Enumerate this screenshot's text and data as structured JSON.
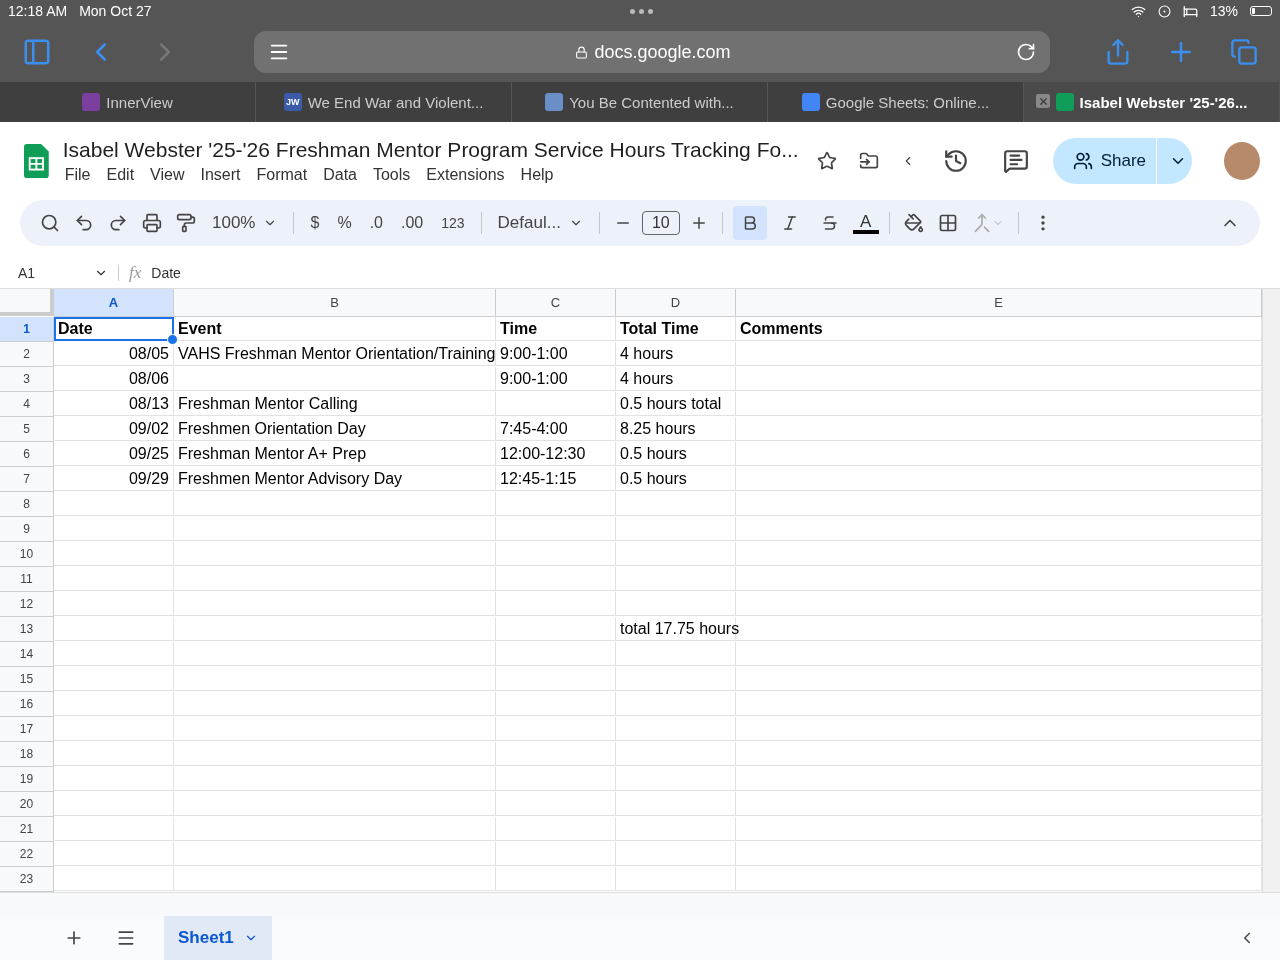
{
  "status_bar": {
    "time": "12:18 AM",
    "date": "Mon Oct 27",
    "battery": "13%"
  },
  "browser": {
    "url": "docs.google.com",
    "tabs": [
      {
        "label": "InnerView",
        "selected": false,
        "color": "#7b3fa0"
      },
      {
        "label": "We End War and Violent...",
        "selected": false,
        "color": "#3b5ba9",
        "favicon_text": "JW"
      },
      {
        "label": "You Be Contented with...",
        "selected": false,
        "color": "#6a8fc8"
      },
      {
        "label": "Google Sheets: Online...",
        "selected": false,
        "color": "#4285f4"
      },
      {
        "label": "Isabel Webster '25-'26...",
        "selected": true,
        "color": "#0f9d58"
      }
    ]
  },
  "doc": {
    "title": "Isabel Webster '25-'26 Freshman Mentor Program Service Hours Tracking Fo...",
    "menus": [
      "File",
      "Edit",
      "View",
      "Insert",
      "Format",
      "Data",
      "Tools",
      "Extensions",
      "Help"
    ],
    "share": "Share"
  },
  "toolbar": {
    "zoom": "100%",
    "currency": "$",
    "percent": "%",
    "decrease_decimal": ".0",
    "increase_decimal": ".00",
    "number_format": "123",
    "font": "Defaul...",
    "font_size": "10",
    "bold": true,
    "text_color": "A"
  },
  "formula_bar": {
    "cell": "A1",
    "fx": "fx",
    "value": "Date"
  },
  "sheet": {
    "columns": [
      {
        "label": "A",
        "selected": true
      },
      {
        "label": "B",
        "selected": false
      },
      {
        "label": "C",
        "selected": false
      },
      {
        "label": "D",
        "selected": false
      },
      {
        "label": "E",
        "selected": false
      }
    ],
    "header_row": {
      "number": "1",
      "selected": true,
      "cells": {
        "a": "Date",
        "b": "Event",
        "c": "Time",
        "d": "Total Time",
        "e": "Comments"
      }
    },
    "rows": [
      {
        "number": "2",
        "selected": false,
        "cells": {
          "a": "08/05",
          "b": "VAHS Freshman Mentor Orientation/Training",
          "c": "9:00-1:00",
          "d": "4 hours"
        }
      },
      {
        "number": "3",
        "selected": false,
        "cells": {
          "a": "08/06",
          "c": "9:00-1:00",
          "d": "4 hours"
        }
      },
      {
        "number": "4",
        "selected": false,
        "cells": {
          "a": "08/13",
          "b": "Freshman Mentor Calling",
          "d": "0.5 hours total"
        }
      },
      {
        "number": "5",
        "selected": false,
        "cells": {
          "a": "09/02",
          "b": "Freshmen Orientation Day",
          "c": "7:45-4:00",
          "d": "8.25 hours"
        }
      },
      {
        "number": "6",
        "selected": false,
        "cells": {
          "a": "09/25",
          "b": "Freshman Mentor A+ Prep",
          "c": "12:00-12:30",
          "d": "0.5 hours"
        }
      },
      {
        "number": "7",
        "selected": false,
        "cells": {
          "a": "09/29",
          "b": "Freshmen Mentor Advisory Day",
          "c": "12:45-1:15",
          "d": "0.5 hours"
        }
      },
      {
        "number": "8",
        "selected": false,
        "cells": {}
      },
      {
        "number": "9",
        "selected": false,
        "cells": {}
      },
      {
        "number": "10",
        "selected": false,
        "cells": {}
      },
      {
        "number": "11",
        "selected": false,
        "cells": {}
      },
      {
        "number": "12",
        "selected": false,
        "cells": {}
      },
      {
        "number": "13",
        "selected": false,
        "cells": {
          "d": "total 17.75 hours"
        }
      },
      {
        "number": "14",
        "selected": false,
        "cells": {}
      },
      {
        "number": "15",
        "selected": false,
        "cells": {}
      },
      {
        "number": "16",
        "selected": false,
        "cells": {}
      },
      {
        "number": "17",
        "selected": false,
        "cells": {}
      },
      {
        "number": "18",
        "selected": false,
        "cells": {}
      },
      {
        "number": "19",
        "selected": false,
        "cells": {}
      },
      {
        "number": "20",
        "selected": false,
        "cells": {}
      },
      {
        "number": "21",
        "selected": false,
        "cells": {}
      },
      {
        "number": "22",
        "selected": false,
        "cells": {}
      },
      {
        "number": "23",
        "selected": false,
        "cells": {}
      }
    ],
    "sheet_tabs": [
      {
        "label": "Sheet1",
        "selected": true
      }
    ]
  }
}
